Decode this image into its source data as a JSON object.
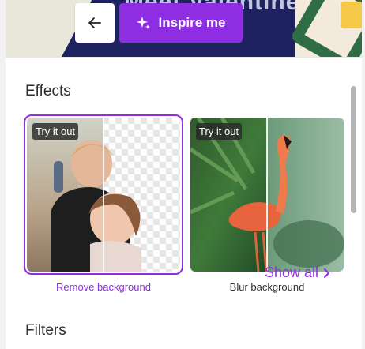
{
  "header": {
    "ghost_text": "Meet Valentine",
    "inspire_label": "Inspire me"
  },
  "effects": {
    "title": "Effects",
    "cards": [
      {
        "badge": "Try it out",
        "caption": "Remove background",
        "selected": true
      },
      {
        "badge": "Try it out",
        "caption": "Blur background",
        "selected": false
      }
    ]
  },
  "filters": {
    "title": "Filters",
    "show_all": "Show all"
  },
  "colors": {
    "accent": "#8e2de2",
    "banner": "#1f2260"
  }
}
